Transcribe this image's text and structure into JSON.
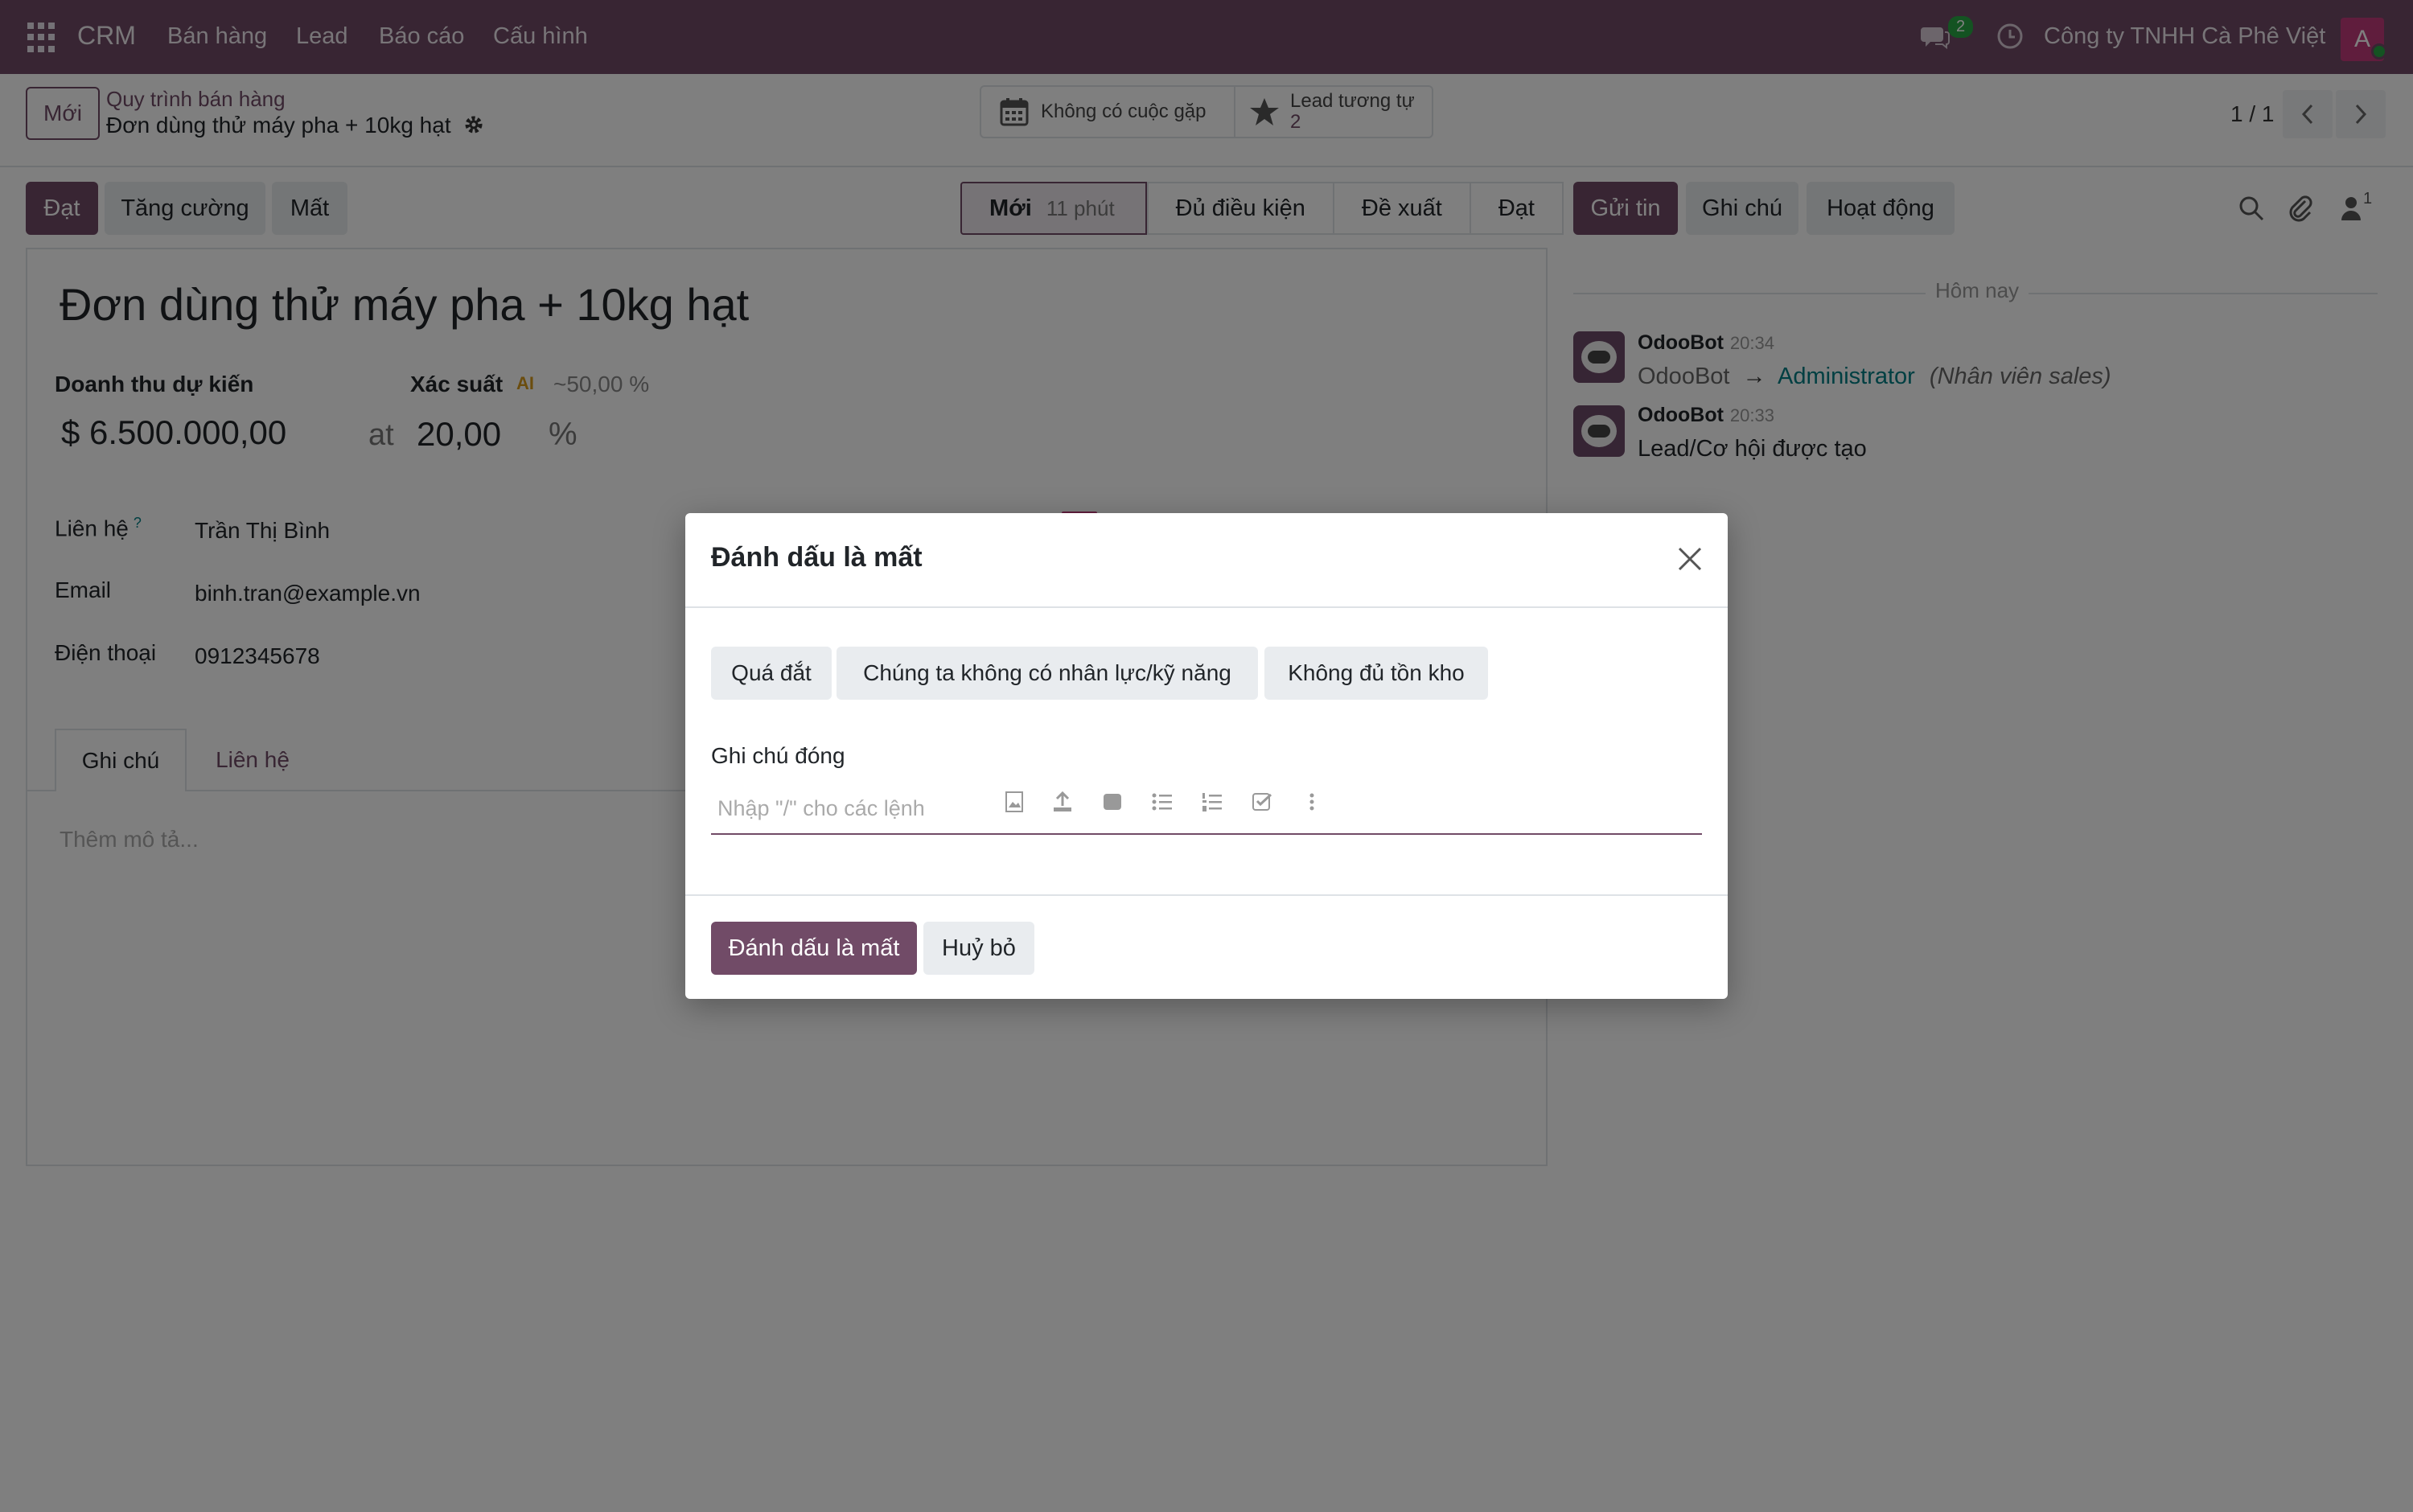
{
  "navbar": {
    "brand": "CRM",
    "menu": [
      "Bán hàng",
      "Lead",
      "Báo cáo",
      "Cấu hình"
    ],
    "chat_count": "2",
    "company": "Công ty TNHH Cà Phê Việt",
    "avatar_letter": "A"
  },
  "control_panel": {
    "new_button": "Mới",
    "breadcrumb_parent": "Quy trình bán hàng",
    "breadcrumb_current": "Đơn dùng thử máy pha + 10kg hạt",
    "meetings_label": "Không có cuộc gặp",
    "similar_leads_label": "Lead tương tự",
    "similar_leads_count": "2",
    "pager": "1 / 1"
  },
  "statusbar": {
    "won_button": "Đạt",
    "enrich_button": "Tăng cường",
    "lost_button": "Mất",
    "stages": [
      {
        "label": "Mới",
        "sub": "11 phút"
      },
      {
        "label": "Đủ điều kiện"
      },
      {
        "label": "Đề xuất"
      },
      {
        "label": "Đạt"
      }
    ]
  },
  "form": {
    "title": "Đơn dùng thử máy pha + 10kg hạt",
    "expected_revenue_label": "Doanh thu dự kiến",
    "expected_revenue": "$ 6.500.000,00",
    "at_label": "at",
    "probability_label": "Xác suất",
    "ai_icon_label": "AI",
    "ai_probability": "~50,00 %",
    "probability_value": "20,00",
    "percent_sign": "%",
    "contact_label": "Liên hệ",
    "contact_help": "?",
    "contact_value": "Trần Thị Bình",
    "email_label": "Email",
    "email_value": "binh.tran@example.vn",
    "phone_label": "Điện thoại",
    "phone_value": "0912345678",
    "tabs": [
      "Ghi chú",
      "Liên hệ"
    ],
    "description_placeholder": "Thêm mô tả..."
  },
  "chatter": {
    "send_message": "Gửi tin",
    "log_note": "Ghi chú",
    "activities": "Hoạt động",
    "followers_count": "1",
    "today_label": "Hôm nay",
    "messages": [
      {
        "author": "OdooBot",
        "time": "20:34",
        "from": "OdooBot",
        "arrow": "→",
        "to": "Administrator",
        "field": "(Nhân viên sales)"
      },
      {
        "author": "OdooBot",
        "time": "20:33",
        "body": "Lead/Cơ hội được tạo"
      }
    ]
  },
  "modal": {
    "title": "Đánh dấu là mất",
    "reasons": [
      "Quá đắt",
      "Chúng ta không có nhân lực/kỹ năng",
      "Không đủ tồn kho"
    ],
    "closing_note_label": "Ghi chú đóng",
    "editor_placeholder": "Nhập \"/\" cho các lệnh",
    "confirm_button": "Đánh dấu là mất",
    "cancel_button": "Huỷ bỏ"
  },
  "colors": {
    "brand": "#714B67",
    "navbar": "#714B67",
    "success_badge": "#28a745",
    "link": "#017E84"
  }
}
